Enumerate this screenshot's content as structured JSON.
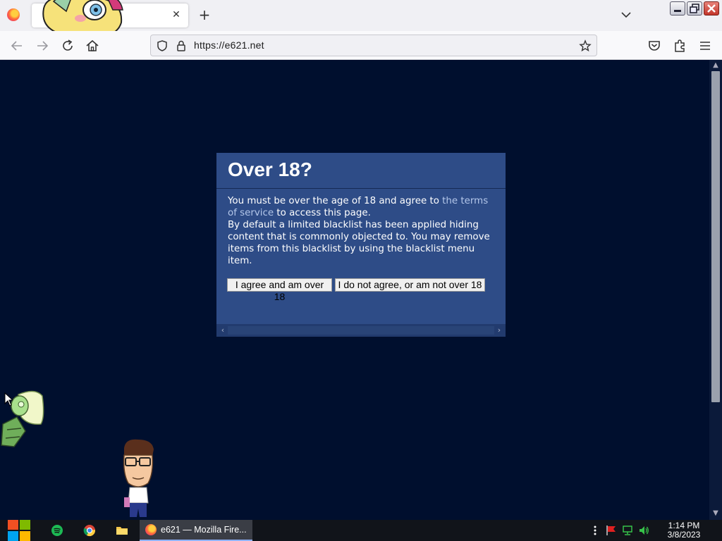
{
  "browser": {
    "tab": {
      "close_glyph": "✕"
    },
    "newtab_glyph": "+",
    "url": "https://e621.net",
    "icons": {
      "back": "arrow-left-icon",
      "forward": "arrow-right-icon",
      "reload": "reload-icon",
      "home": "home-icon",
      "shield": "shield-icon",
      "lock": "lock-icon",
      "bookmark": "star-icon",
      "pocket": "pocket-icon",
      "extensions": "puzzle-icon",
      "menu": "hamburger-menu-icon"
    }
  },
  "dialog": {
    "title": "Over 18?",
    "text_before_link": "You must be over the age of 18 and agree to ",
    "link_text": "the terms of service",
    "text_after_link": " to access this page.",
    "blacklist_text": "By default a limited blacklist has been applied hiding content that is commonly objected to. You may remove items from this blacklist by using the blacklist menu item.",
    "agree_label": "I agree and am over 18",
    "disagree_label": "I do not agree, or am not over 18"
  },
  "taskbar": {
    "task_label": "e621 — Mozilla Fire...",
    "time": "1:14 PM",
    "date": "3/8/2023"
  },
  "colors": {
    "page_background": "#000f2e",
    "dialog_background": "#2e4c87",
    "link": "#b4c7ea",
    "taskbar": "#11141a"
  }
}
